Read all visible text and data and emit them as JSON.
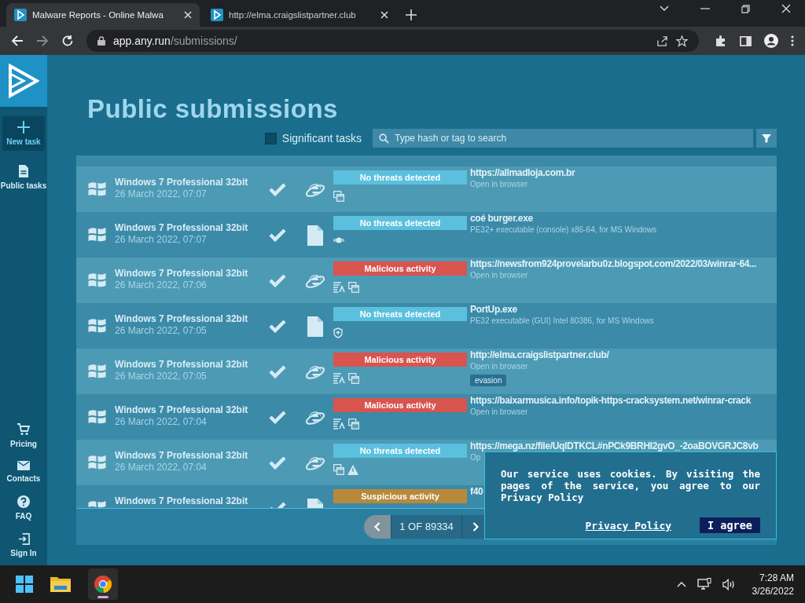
{
  "browser": {
    "tabs": [
      {
        "title": "Malware Reports - Online Malwa",
        "selected": true
      },
      {
        "title": "http://elma.craigslistpartner.club",
        "selected": false
      }
    ],
    "url_host": "app.any.run",
    "url_path": "/submissions/"
  },
  "sidebar": {
    "top": [
      {
        "kind": "plus",
        "label": "New task",
        "selected": true
      },
      {
        "kind": "document",
        "label": "Public tasks",
        "selected": false
      }
    ],
    "bottom": [
      {
        "kind": "cart",
        "label": "Pricing"
      },
      {
        "kind": "mail",
        "label": "Contacts"
      },
      {
        "kind": "help",
        "label": "FAQ"
      },
      {
        "kind": "signin",
        "label": "Sign In"
      }
    ]
  },
  "page": {
    "title": "Public submissions",
    "significant": {
      "label": "Significant tasks",
      "checked": false
    },
    "search": {
      "placeholder": "Type hash or tag to search"
    }
  },
  "tasks": [
    {
      "os": "Windows 7 Professional 32bit",
      "date": "26 March 2022, 07:07",
      "object": {
        "kind": "url"
      },
      "verdict": {
        "kind": "clean",
        "label": "No threats detected"
      },
      "indicators": [
        {
          "kind": "windows"
        }
      ],
      "name": "https://allmadloja.com.br",
      "info": "Open in browser"
    },
    {
      "os": "Windows 7 Professional 32bit",
      "date": "26 March 2022, 07:07",
      "object": {
        "kind": "file"
      },
      "verdict": {
        "kind": "clean",
        "label": "No threats detected"
      },
      "indicators": [
        {
          "kind": "network"
        }
      ],
      "name": "coé burger.exe",
      "info": "PE32+ executable (console) x86-64, for MS Windows"
    },
    {
      "os": "Windows 7 Professional 32bit",
      "date": "26 March 2022, 07:06",
      "object": {
        "kind": "url"
      },
      "verdict": {
        "kind": "malicious",
        "label": "Malicious activity"
      },
      "indicators": [
        {
          "kind": "script"
        },
        {
          "kind": "windows"
        }
      ],
      "name": "https://newsfrom924provelarbu0z.blogspot.com/2022/03/winrar-64...",
      "info": "Open in browser"
    },
    {
      "os": "Windows 7 Professional 32bit",
      "date": "26 March 2022, 07:05",
      "object": {
        "kind": "file"
      },
      "verdict": {
        "kind": "clean",
        "label": "No threats detected"
      },
      "indicators": [
        {
          "kind": "shield"
        }
      ],
      "name": "PortUp.exe",
      "info": "PE32 executable (GUI) Intel 80386, for MS Windows"
    },
    {
      "os": "Windows 7 Professional 32bit",
      "date": "26 March 2022, 07:05",
      "object": {
        "kind": "url"
      },
      "verdict": {
        "kind": "malicious",
        "label": "Malicious activity"
      },
      "indicators": [
        {
          "kind": "script"
        },
        {
          "kind": "windows"
        }
      ],
      "name": "http://elma.craigslistpartner.club/",
      "info": "Open in browser",
      "tags": [
        "evasion"
      ]
    },
    {
      "os": "Windows 7 Professional 32bit",
      "date": "26 March 2022, 07:04",
      "object": {
        "kind": "url"
      },
      "verdict": {
        "kind": "malicious",
        "label": "Malicious activity"
      },
      "indicators": [
        {
          "kind": "script"
        },
        {
          "kind": "windows"
        }
      ],
      "name": "https://baixarmusica.info/topik-https-cracksystem.net/winrar-crack",
      "info": "Open in browser"
    },
    {
      "os": "Windows 7 Professional 32bit",
      "date": "26 March 2022, 07:04",
      "object": {
        "kind": "url"
      },
      "verdict": {
        "kind": "clean",
        "label": "No threats detected"
      },
      "indicators": [
        {
          "kind": "windows"
        },
        {
          "kind": "warning"
        }
      ],
      "name": "https://mega.nz/file/UqlDTKCL#nPCk9BRHI2gvO_-2oaBOVGRJC8vb",
      "info": "Op"
    },
    {
      "os": "Windows 7 Professional 32bit",
      "object": {
        "kind": "file"
      },
      "verdict": {
        "kind": "suspicious",
        "label": "Suspicious activity"
      },
      "name": "f40"
    }
  ],
  "pagination": {
    "label": "1 OF 89334"
  },
  "cookie": {
    "text": "Our service uses cookies. By visiting the pages of the service, you agree to our Privacy Policy",
    "link": "Privacy Policy",
    "button": "I agree"
  },
  "taskbar": {
    "time": "7:28 AM",
    "date": "3/26/2022"
  }
}
